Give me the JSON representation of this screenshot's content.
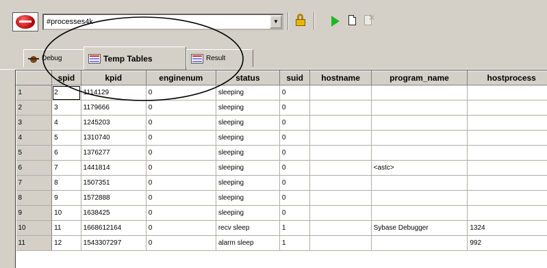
{
  "toolbar": {
    "object_combo_value": "#processes4k",
    "icons": [
      "lock-icon",
      "play-icon",
      "document-icon",
      "stop-icon"
    ]
  },
  "tabs": [
    {
      "label": "Debug",
      "icon": "bug-icon",
      "active": false
    },
    {
      "label": "Temp Tables",
      "icon": "table-icon",
      "active": true
    },
    {
      "label": "Result",
      "icon": "table-icon",
      "active": false
    }
  ],
  "grid": {
    "columns": [
      "spid",
      "kpid",
      "enginenum",
      "status",
      "suid",
      "hostname",
      "program_name",
      "hostprocess"
    ],
    "rows": [
      {
        "num": "1",
        "cells": [
          "2",
          "1114129",
          "0",
          "sleeping",
          "0",
          "",
          "",
          ""
        ]
      },
      {
        "num": "2",
        "cells": [
          "3",
          "1179666",
          "0",
          "sleeping",
          "0",
          "",
          "",
          ""
        ]
      },
      {
        "num": "3",
        "cells": [
          "4",
          "1245203",
          "0",
          "sleeping",
          "0",
          "",
          "",
          ""
        ]
      },
      {
        "num": "4",
        "cells": [
          "5",
          "1310740",
          "0",
          "sleeping",
          "0",
          "",
          "",
          ""
        ]
      },
      {
        "num": "5",
        "cells": [
          "6",
          "1376277",
          "0",
          "sleeping",
          "0",
          "",
          "",
          ""
        ]
      },
      {
        "num": "6",
        "cells": [
          "7",
          "1441814",
          "0",
          "sleeping",
          "0",
          "",
          "<astc>",
          ""
        ]
      },
      {
        "num": "7",
        "cells": [
          "8",
          "1507351",
          "0",
          "sleeping",
          "0",
          "",
          "",
          ""
        ]
      },
      {
        "num": "8",
        "cells": [
          "9",
          "1572888",
          "0",
          "sleeping",
          "0",
          "",
          "",
          ""
        ]
      },
      {
        "num": "9",
        "cells": [
          "10",
          "1638425",
          "0",
          "sleeping",
          "0",
          "",
          "",
          ""
        ]
      },
      {
        "num": "10",
        "cells": [
          "11",
          "1668612164",
          "0",
          "recv sleep",
          "1",
          "",
          "Sybase Debugger",
          "1324"
        ]
      },
      {
        "num": "11",
        "cells": [
          "12",
          "1543307297",
          "0",
          "alarm sleep",
          "1",
          "",
          "",
          "992"
        ]
      }
    ]
  },
  "colors": {
    "chrome": "#d4d0c8",
    "play_green": "#1fb81f",
    "annotation_stroke": "#000000"
  }
}
